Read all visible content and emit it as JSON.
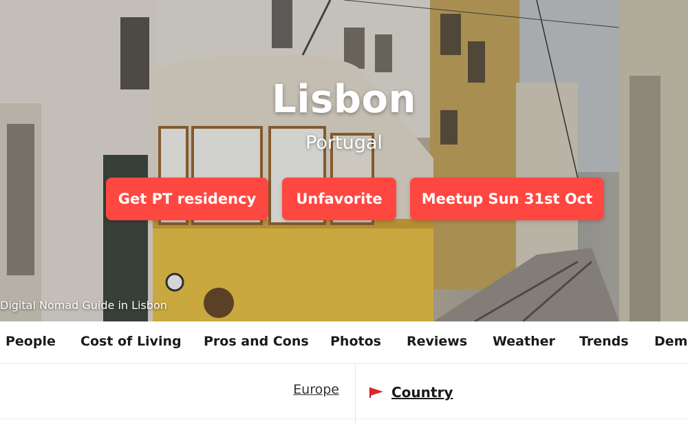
{
  "hero": {
    "title": "Lisbon",
    "subtitle": "Portugal",
    "caption": "Digital Nomad Guide in Lisbon",
    "buttons": {
      "residency": "Get PT residency",
      "unfavorite": "Unfavorite",
      "meetup": "Meetup Sun 31st Oct"
    },
    "button_color": "#ff4742"
  },
  "tabs": [
    "People",
    "Cost of Living",
    "Pros and Cons",
    "Photos",
    "Reviews",
    "Weather",
    "Trends",
    "Demo"
  ],
  "info": {
    "region": "Europe",
    "country_label": "Country",
    "flag_color": "#e0242c"
  }
}
